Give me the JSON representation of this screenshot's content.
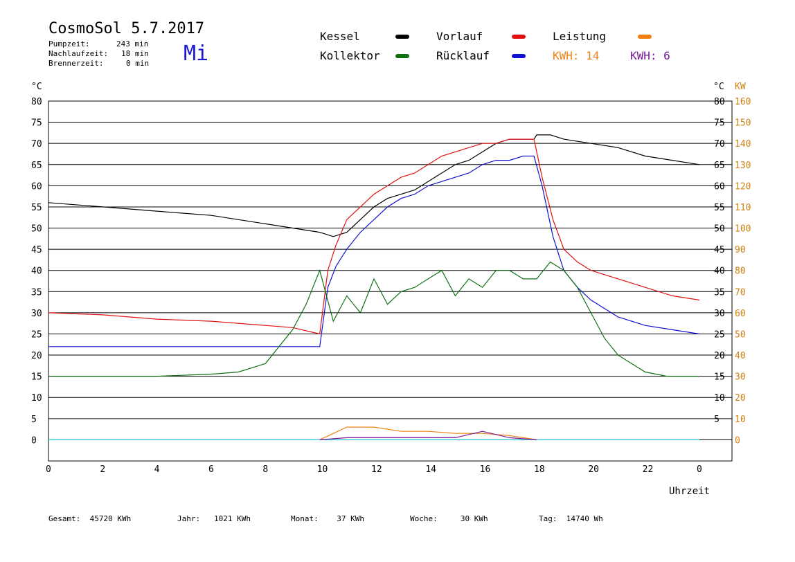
{
  "header": {
    "title": "CosmoSol 5.7.2017",
    "day": "Mi",
    "pumpzeit_label": "Pumpzeit:",
    "pumpzeit_value": "243 min",
    "nachlauf_label": "Nachlaufzeit:",
    "nachlauf_value": "18 min",
    "brenner_label": "Brennerzeit:",
    "brenner_value": "0 min"
  },
  "legend": {
    "kessel": "Kessel",
    "vorlauf": "Vorlauf",
    "leistung": "Leistung",
    "kollektor": "Kollektor",
    "ruecklauf": "Rücklauf",
    "kwh1": "KWH: 14",
    "kwh2": "KWH: 6"
  },
  "colors": {
    "kessel": "#000000",
    "vorlauf": "#e01010",
    "leistung": "#f08010",
    "kollektor": "#107010",
    "ruecklauf": "#1010d0",
    "kwh2": "#7a1a9a",
    "baseline": "#40d0d8",
    "axis_right": "#d08010"
  },
  "footer": {
    "gesamt": "Gesamt:  45720 KWh",
    "jahr": "Jahr:   1021 KWh",
    "monat": "Monat:    37 KWh",
    "woche": "Woche:     30 KWh",
    "tag": "Tag:  14740 Wh"
  },
  "chart_data": {
    "type": "line",
    "xlabel": "Uhrzeit",
    "ylabel_left": "°C",
    "ylabel_right": "°C",
    "ylabel_right2": "KW",
    "xlim": [
      0,
      24
    ],
    "ylim": [
      -5,
      80
    ],
    "ylim_kw": [
      -10,
      160
    ],
    "grid": true,
    "x_ticks": [
      "0",
      "2",
      "4",
      "6",
      "8",
      "10",
      "12",
      "14",
      "16",
      "18",
      "20",
      "22",
      "0"
    ],
    "y_ticks": [
      "0",
      "5",
      "10",
      "15",
      "20",
      "25",
      "30",
      "35",
      "40",
      "45",
      "50",
      "55",
      "60",
      "65",
      "70",
      "75",
      "80"
    ],
    "y_ticks_right": [
      "5",
      "10",
      "15",
      "20",
      "25",
      "30",
      "35",
      "40",
      "45",
      "50",
      "55",
      "60",
      "65",
      "70",
      "75",
      "80"
    ],
    "kw_ticks": [
      "0",
      "10",
      "20",
      "30",
      "40",
      "50",
      "60",
      "70",
      "80",
      "90",
      "100",
      "110",
      "120",
      "130",
      "140",
      "150",
      "160"
    ],
    "series": [
      {
        "name": "Kessel",
        "x": [
          0,
          2,
          4,
          6,
          8,
          10,
          10.5,
          11,
          11.5,
          12,
          12.5,
          13,
          13.5,
          14,
          14.5,
          15,
          15.5,
          16,
          16.5,
          17,
          17.5,
          17.9,
          18,
          18.5,
          19,
          20,
          21,
          22,
          23,
          24
        ],
        "y": [
          56,
          55,
          54,
          53,
          51,
          49,
          48,
          49,
          52,
          55,
          57,
          58,
          59,
          61,
          63,
          65,
          66,
          68,
          70,
          71,
          71,
          71,
          72,
          72,
          71,
          70,
          69,
          67,
          66,
          65
        ]
      },
      {
        "name": "Vorlauf",
        "x": [
          0,
          2,
          4,
          6,
          8,
          9,
          10,
          10.3,
          10.6,
          11,
          11.5,
          12,
          12.5,
          13,
          13.5,
          14,
          14.5,
          15,
          15.5,
          16,
          16.5,
          17,
          17.5,
          17.9,
          18.2,
          18.6,
          19,
          19.5,
          20,
          21,
          22,
          23,
          24
        ],
        "y": [
          30,
          29.5,
          28.5,
          28,
          27,
          26.5,
          25,
          40,
          46,
          52,
          55,
          58,
          60,
          62,
          63,
          65,
          67,
          68,
          69,
          70,
          70,
          71,
          71,
          71,
          62,
          52,
          45,
          42,
          40,
          38,
          36,
          34,
          33
        ]
      },
      {
        "name": "Rücklauf",
        "x": [
          0,
          2,
          4,
          6,
          8,
          9,
          10,
          10.3,
          10.6,
          11,
          11.5,
          12,
          12.5,
          13,
          13.5,
          14,
          14.5,
          15,
          15.5,
          16,
          16.5,
          17,
          17.5,
          17.9,
          18.2,
          18.6,
          19,
          19.5,
          20,
          21,
          22,
          23,
          24
        ],
        "y": [
          22,
          22,
          22,
          22,
          22,
          22,
          22,
          36,
          41,
          45,
          49,
          52,
          55,
          57,
          58,
          60,
          61,
          62,
          63,
          65,
          66,
          66,
          67,
          67,
          60,
          48,
          40,
          36,
          33,
          29,
          27,
          26,
          25
        ]
      },
      {
        "name": "Kollektor",
        "x": [
          0,
          2,
          4,
          6,
          7,
          8,
          8.5,
          9,
          9.5,
          10,
          10.5,
          11,
          11.5,
          12,
          12.5,
          13,
          13.5,
          14,
          14.5,
          15,
          15.5,
          16,
          16.5,
          17,
          17.5,
          18,
          18.5,
          19,
          19.5,
          20,
          20.5,
          21,
          22,
          22.8,
          23,
          23.2,
          24
        ],
        "y": [
          15,
          15,
          15,
          15.5,
          16,
          18,
          22,
          26,
          32,
          40,
          28,
          34,
          30,
          38,
          32,
          35,
          36,
          38,
          40,
          34,
          38,
          36,
          40,
          40,
          38,
          38,
          42,
          40,
          36,
          30,
          24,
          20,
          16,
          15,
          15,
          15,
          15
        ]
      },
      {
        "name": "Leistung",
        "x": [
          10,
          11,
          12,
          13,
          14,
          15,
          16,
          17,
          18
        ],
        "y": [
          0,
          3,
          3,
          2,
          2,
          1.5,
          1.5,
          1,
          0
        ]
      },
      {
        "name": "KWH: 6",
        "x": [
          10,
          11,
          12,
          13,
          14,
          15,
          16,
          17,
          18
        ],
        "y": [
          0,
          0.5,
          0.5,
          0.5,
          0.5,
          0.5,
          2,
          0.5,
          0
        ]
      }
    ]
  }
}
